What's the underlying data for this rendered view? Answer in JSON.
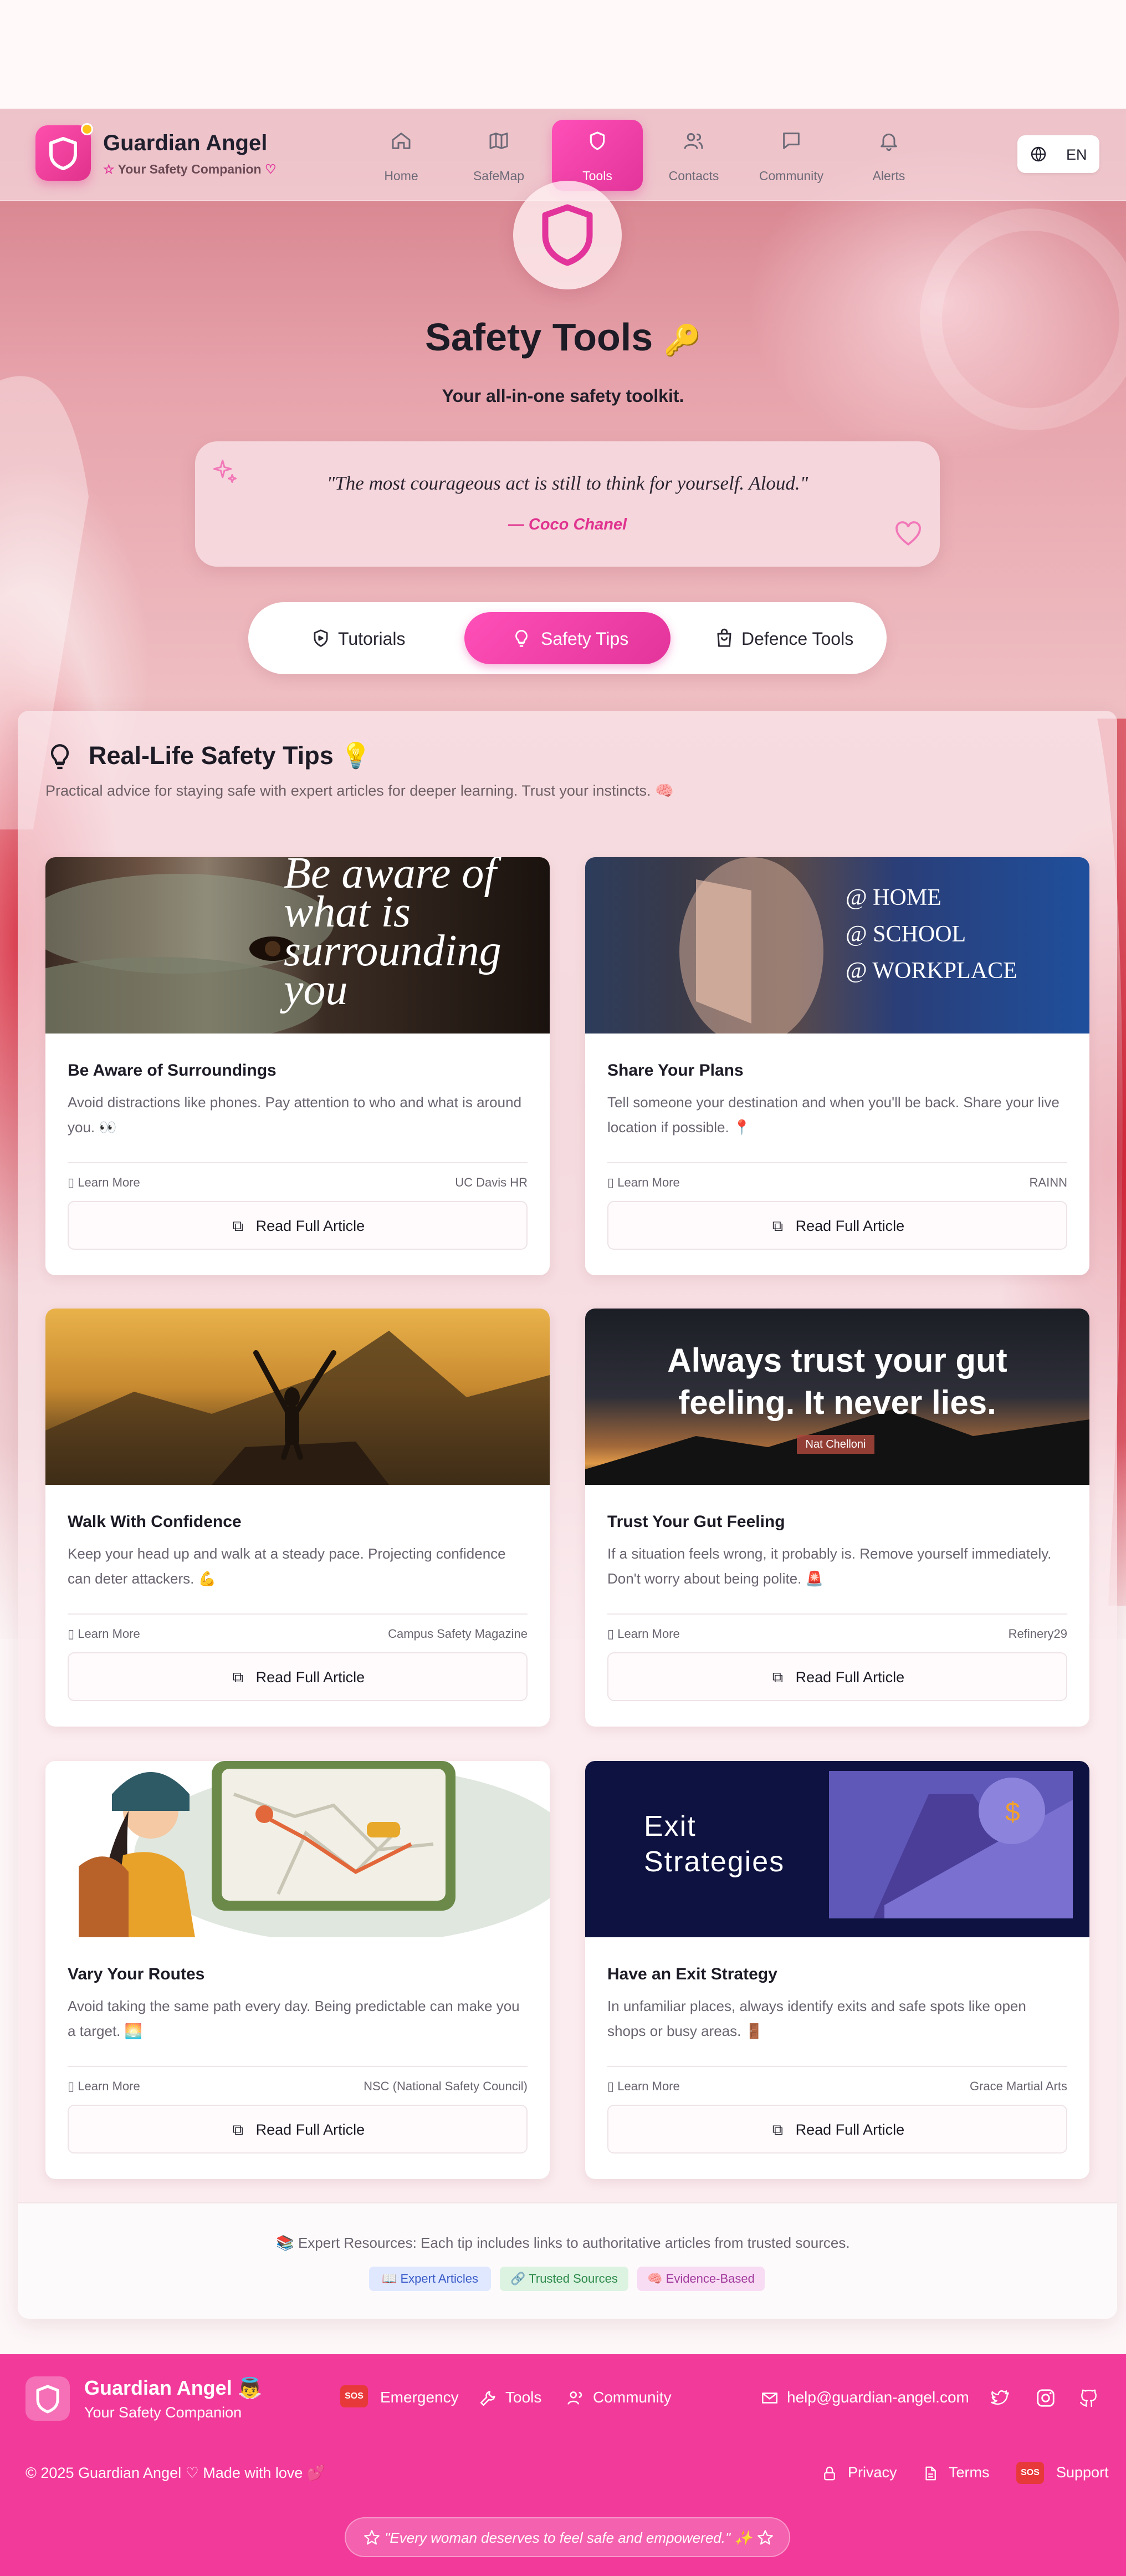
{
  "app": {
    "name": "Guardian Angel",
    "tagline": "Your Safety Companion"
  },
  "nav": {
    "items": [
      {
        "label": "Home",
        "icon": "home-icon"
      },
      {
        "label": "SafeMap",
        "icon": "map-icon"
      },
      {
        "label": "Tools",
        "icon": "shield-icon",
        "active": true
      },
      {
        "label": "Contacts",
        "icon": "users-icon"
      },
      {
        "label": "Community",
        "icon": "chat-icon"
      },
      {
        "label": "Alerts",
        "icon": "bell-icon"
      }
    ],
    "language": "EN"
  },
  "hero": {
    "title": "Safety Tools",
    "title_emoji": "🔑",
    "subtitle": "Your all-in-one safety toolkit.",
    "quote": "\"The most courageous act is still to think for yourself. Aloud.\"",
    "quote_author": "— Coco Chanel"
  },
  "tabs": [
    {
      "label": "Tutorials",
      "icon": "video-shield-icon"
    },
    {
      "label": "Safety Tips",
      "icon": "lightbulb-icon",
      "active": true
    },
    {
      "label": "Defence Tools",
      "icon": "bag-icon"
    }
  ],
  "section": {
    "title": "Real-Life Safety Tips 💡",
    "subtitle": "Practical advice for staying safe with expert articles for deeper learning. Trust your instincts. 🧠"
  },
  "card_common": {
    "learn_more": "Learn More",
    "read_full": "Read Full Article"
  },
  "cards": [
    {
      "title": "Be Aware of Surroundings",
      "desc": "Avoid distractions like phones. Pay attention to who and what is around you. 👀",
      "source": "UC Davis HR",
      "image_text": [
        "Be aware of",
        "what is",
        "surrounding",
        "you"
      ]
    },
    {
      "title": "Share Your Plans",
      "desc": "Tell someone your destination and when you'll be back. Share your live location if possible. 📍",
      "source": "RAINN",
      "image_text": [
        "@ HOME",
        "@ SCHOOL",
        "@ WORKPLACE"
      ]
    },
    {
      "title": "Walk With Confidence",
      "desc": "Keep your head up and walk at a steady pace. Projecting confidence can deter attackers. 💪",
      "source": "Campus Safety Magazine"
    },
    {
      "title": "Trust Your Gut Feeling",
      "desc": "If a situation feels wrong, it probably is. Remove yourself immediately. Don't worry about being polite. 🚨",
      "source": "Refinery29",
      "image_text": [
        "Always trust your gut",
        "feeling. It never lies.",
        "Nat Chelloni"
      ]
    },
    {
      "title": "Vary Your Routes",
      "desc": "Avoid taking the same path every day. Being predictable can make you a target. 🌅",
      "source": "NSC (National Safety Council)"
    },
    {
      "title": "Have an Exit Strategy",
      "desc": "In unfamiliar places, always identify exits and safe spots like open shops or busy areas. 🚪",
      "source": "Grace Martial Arts",
      "image_text": [
        "Exit",
        "Strategies"
      ]
    }
  ],
  "resources": {
    "text": "📚 Expert Resources: Each tip includes links to authoritative articles from trusted sources.",
    "badges": [
      "📖 Expert Articles",
      "🔗 Trusted Sources",
      "🧠 Evidence-Based"
    ]
  },
  "footer": {
    "brand": "Guardian Angel 👼",
    "tagline": "Your Safety Companion",
    "links": [
      "Emergency",
      "Tools",
      "Community"
    ],
    "email": "help@guardian-angel.com",
    "copyright": "© 2025 Guardian Angel ♡ Made with love 💕",
    "legal": [
      "Privacy",
      "Terms",
      "Support"
    ],
    "sos": "SOS",
    "quote": "\"Every woman deserves to feel safe and empowered.\" ✨"
  },
  "colors": {
    "accent": "#e2349a",
    "footer": "#f23a9a",
    "sos": "#e8393a"
  }
}
